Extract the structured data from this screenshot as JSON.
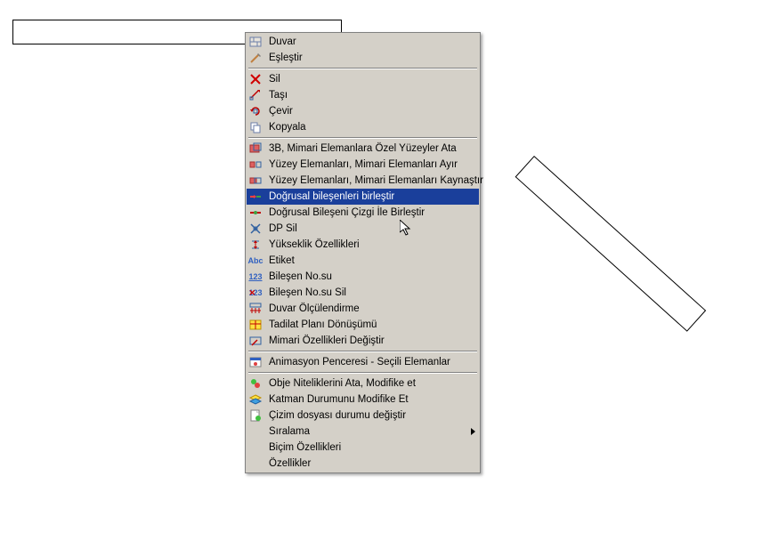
{
  "menu": {
    "items": [
      {
        "label": "Duvar"
      },
      {
        "label": "Eşleştir"
      },
      {
        "sep": true
      },
      {
        "label": "Sil"
      },
      {
        "label": "Taşı"
      },
      {
        "label": "Çevir"
      },
      {
        "label": "Kopyala"
      },
      {
        "sep": true
      },
      {
        "label": "3B, Mimari Elemanlara Özel Yüzeyler Ata"
      },
      {
        "label": "Yüzey Elemanları, Mimari Elemanları Ayır"
      },
      {
        "label": "Yüzey Elemanları, Mimari Elemanları Kaynaştır"
      },
      {
        "label": "Doğrusal bileşenleri birleştir",
        "hovered": true
      },
      {
        "label": "Doğrusal Bileşeni Çizgi İle Birleştir"
      },
      {
        "label": "DP Sil"
      },
      {
        "label": "Yükseklik Özellikleri"
      },
      {
        "label": "Etiket"
      },
      {
        "label": "Bileşen No.su"
      },
      {
        "label": "Bileşen No.su Sil"
      },
      {
        "label": "Duvar Ölçülendirme"
      },
      {
        "label": "Tadilat Planı Dönüşümü"
      },
      {
        "label": "Mimari Özellikleri Değiştir"
      },
      {
        "sep": true
      },
      {
        "label": "Animasyon Penceresi - Seçili Elemanlar"
      },
      {
        "sep": true
      },
      {
        "label": "Obje Niteliklerini Ata, Modifike et"
      },
      {
        "label": "Katman Durumunu Modifike Et"
      },
      {
        "label": "Çizim dosyası durumu değiştir"
      },
      {
        "label": "Sıralama",
        "submenu": true
      },
      {
        "label": "Biçim Özellikleri"
      },
      {
        "label": "Özellikler"
      }
    ]
  }
}
